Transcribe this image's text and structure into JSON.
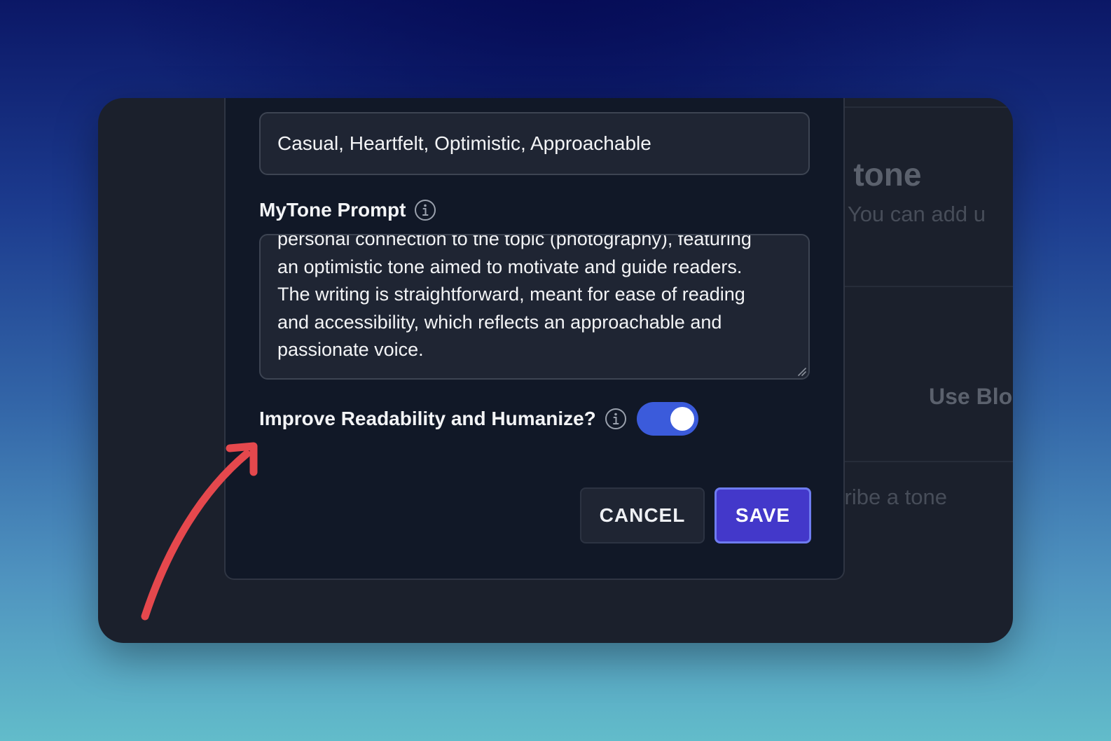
{
  "background": {
    "title_fragment": "v tone",
    "subtitle_fragment": "y. You can add u",
    "use_blog_fragment": "Use Blo",
    "describe_fragment": "cribe a tone"
  },
  "modal": {
    "tone_input": {
      "value": "Casual, Heartfelt, Optimistic, Approachable"
    },
    "prompt": {
      "label": "MyTone Prompt",
      "text": "personal connection to the topic (photography), featuring\nan optimistic tone aimed to motivate and guide readers.\nThe writing is straightforward, meant for ease of reading\nand accessibility, which reflects an approachable and\npassionate voice."
    },
    "readability": {
      "label": "Improve Readability and Humanize?",
      "enabled": true
    },
    "buttons": {
      "cancel": "CANCEL",
      "save": "SAVE"
    }
  },
  "colors": {
    "accent": "#4338ca",
    "toggle_on": "#3b5bdb",
    "annotation_arrow": "#e5484d"
  },
  "icons": {
    "info": "info-icon",
    "annotation": "curved-arrow-annotation-icon"
  }
}
